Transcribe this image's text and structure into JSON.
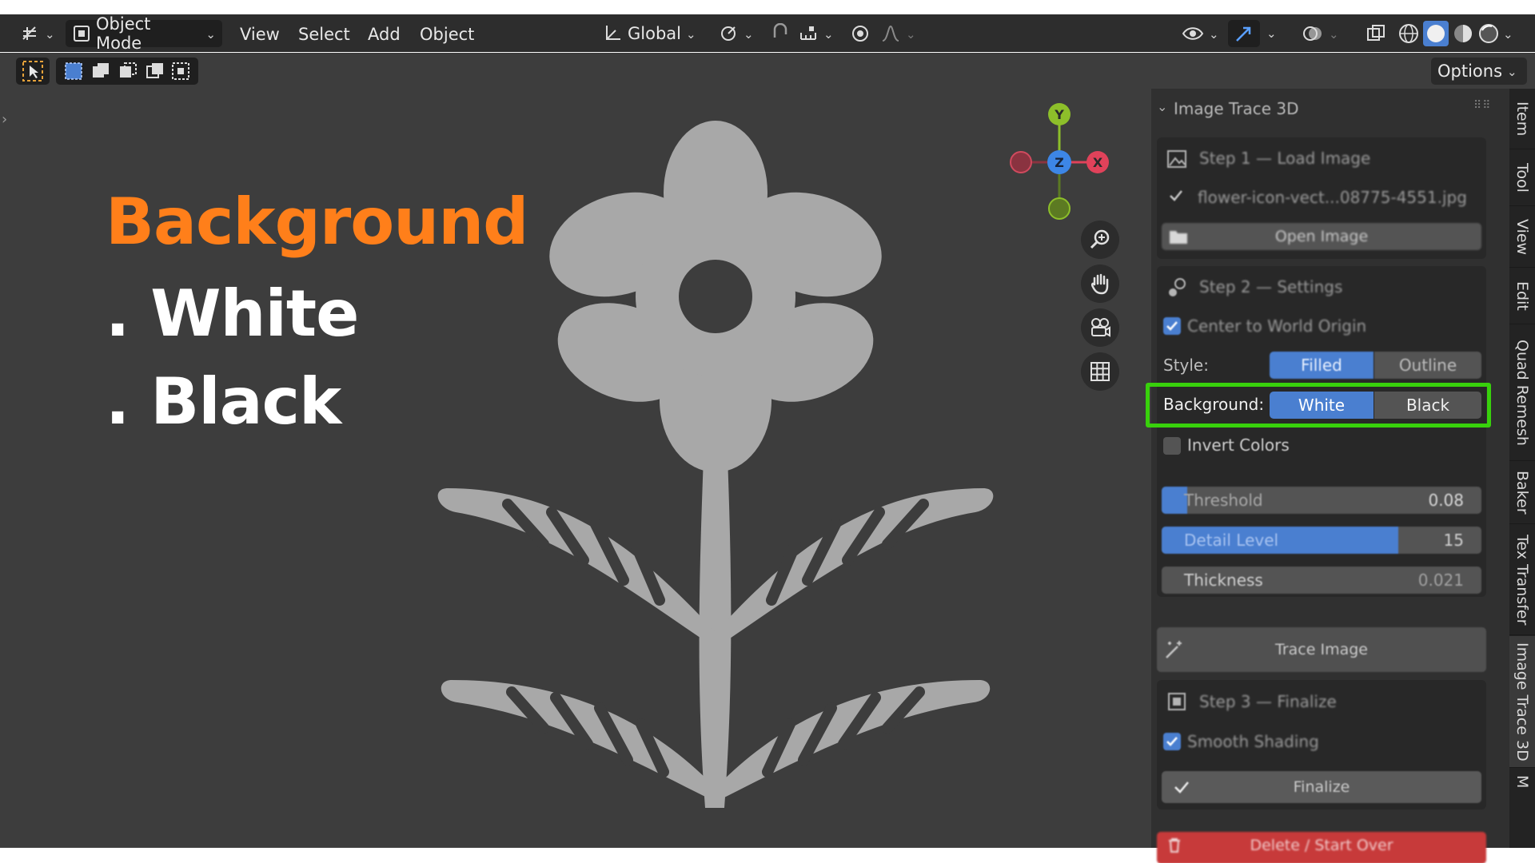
{
  "header": {
    "mode_label": "Object Mode",
    "menus": [
      "View",
      "Select",
      "Add",
      "Object"
    ],
    "transform_orientation": "Global"
  },
  "toolbar2": {
    "options_label": "Options"
  },
  "overlay": {
    "title": "Background",
    "items": [
      ". White",
      ". Black"
    ],
    "title_color": "#ff7f1a"
  },
  "gizmo": {
    "x": "X",
    "y": "Y",
    "z": "Z"
  },
  "panel": {
    "title": "Image Trace 3D",
    "step1_title": "Step 1 — Load Image",
    "loaded_file": "flower-icon-vect...08775-4551.jpg",
    "open_image": "Open Image",
    "step2_title": "Step 2 — Settings",
    "center_origin": "Center to World Origin",
    "style_label": "Style:",
    "style_options": [
      "Filled",
      "Outline"
    ],
    "style_selected": "Filled",
    "background_label": "Background:",
    "background_options": [
      "White",
      "Black"
    ],
    "background_selected": "White",
    "invert_colors": "Invert Colors",
    "threshold": {
      "label": "Threshold",
      "value": "0.08",
      "fill": 0.08
    },
    "detail_level": {
      "label": "Detail Level",
      "value": "15",
      "fill": 0.74
    },
    "thickness": {
      "label": "Thickness",
      "value": "0.021"
    },
    "trace_image": "Trace Image",
    "step3_title": "Step 3 — Finalize",
    "smooth_shading": "Smooth Shading",
    "finalize": "Finalize",
    "delete": "Delete / Start Over"
  },
  "tabs": [
    "Item",
    "Tool",
    "View",
    "Edit",
    "Quad Remesh",
    "Baker",
    "Tex Transfer",
    "Image Trace 3D",
    "M"
  ],
  "active_tab": "Image Trace 3D",
  "colors": {
    "accent": "#4a7fd0",
    "highlight": "#38d10c",
    "delete": "#c73a3a"
  }
}
